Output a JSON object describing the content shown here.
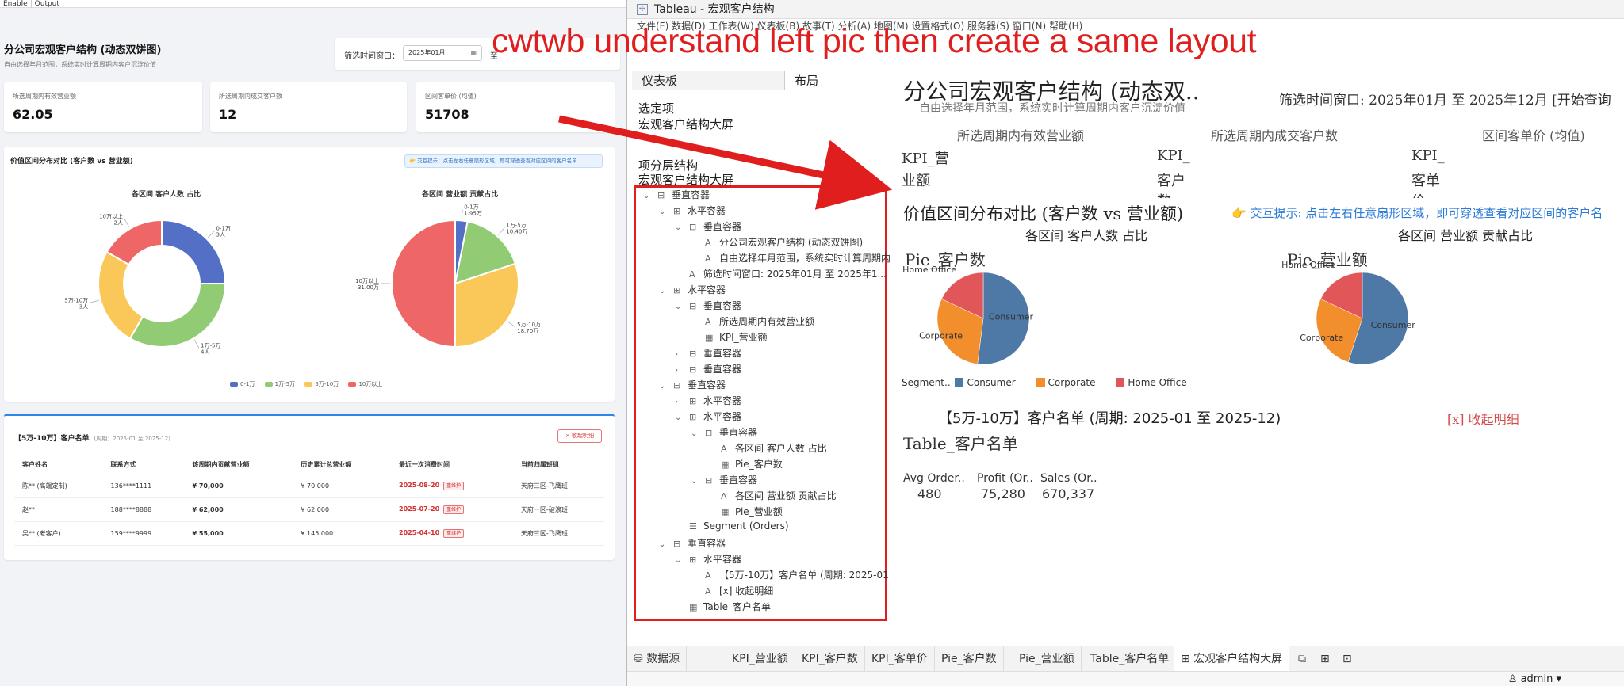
{
  "left_app": {
    "top_tabs": [
      "Enable",
      "Output"
    ],
    "title": "分公司宏观客户结构 (动态双饼图)",
    "subtitle": "自由选择年月范围，系统实时计算周期内客户沉淀价值",
    "filter_label": "筛选时间窗口：",
    "filter_from": "2025年01月",
    "filter_to_label": "至",
    "kpis": [
      {
        "label": "所选周期内有效营业额",
        "value": "62.05"
      },
      {
        "label": "所选周期内成交客户数",
        "value": "12"
      },
      {
        "label": "区间客单价 (均值)",
        "value": "51708"
      }
    ],
    "panel_title": "价值区间分布对比 (客户数 vs 营业额)",
    "tip": "👉 交互提示：点击左右任意扇形区域，即可穿透查看对应区间的客户名单",
    "donut_title": "各区间 客户人数 占比",
    "pie_title": "各区间 营业额 贡献占比",
    "legend": [
      "0-1万",
      "1万-5万",
      "5万-10万",
      "10万以上"
    ],
    "table_title": "【5万-10万】客户名单",
    "table_period": "(周期：2025-01 至 2025-12)",
    "collapse": "× 收起明细",
    "columns": [
      "客户姓名",
      "联系方式",
      "该周期内贡献营业额",
      "历史累计总营业额",
      "最近一次消费时间",
      "当前归属班组"
    ],
    "rows": [
      {
        "name": "陈** (高端定制)",
        "phone": "136****1111",
        "period": "¥ 70,000",
        "total": "¥ 70,000",
        "last": "2025-08-20",
        "badge": "重维护",
        "team": "天府三区-飞鹰班"
      },
      {
        "name": "赵**",
        "phone": "188****8888",
        "period": "¥ 62,000",
        "total": "¥ 62,000",
        "last": "2025-07-20",
        "badge": "重维护",
        "team": "天府一区-破浪班"
      },
      {
        "name": "吴** (老客户)",
        "phone": "159****9999",
        "period": "¥ 55,000",
        "total": "¥ 145,000",
        "last": "2025-04-10",
        "badge": "重维护",
        "team": "天府三区-飞鹰班"
      }
    ],
    "colors": {
      "c1": "#5470c6",
      "c2": "#91cc75",
      "c3": "#fac858",
      "c4": "#ee6666",
      "blue": "#1f77d6",
      "red": "#d32f2f"
    }
  },
  "chart_data": [
    {
      "type": "pie",
      "title": "各区间 客户人数 占比",
      "categories": [
        "0-1万",
        "1万-5万",
        "5万-10万",
        "10万以上"
      ],
      "values": [
        3,
        4,
        3,
        2
      ],
      "labels": [
        [
          "0-1万",
          "3人"
        ],
        [
          "1万-5万",
          "4人"
        ],
        [
          "5万-10万",
          "3人"
        ],
        [
          "10万以上",
          "2人"
        ]
      ]
    },
    {
      "type": "pie",
      "title": "各区间 营业额 贡献占比",
      "categories": [
        "0-1万",
        "1万-5万",
        "5万-10万",
        "10万以上"
      ],
      "values": [
        1.95,
        10.4,
        18.7,
        31.0
      ],
      "labels": [
        [
          "0-1万",
          "1.95万"
        ],
        [
          "1万-5万",
          "10.40万"
        ],
        [
          "5万-10万",
          "18.70万"
        ],
        [
          "10万以上",
          "31.00万"
        ]
      ]
    },
    {
      "type": "pie",
      "title": "Pie_客户数",
      "categories": [
        "Consumer",
        "Corporate",
        "Home Office"
      ],
      "values": [
        52,
        30,
        18
      ]
    },
    {
      "type": "pie",
      "title": "Pie_营业额",
      "categories": [
        "Consumer",
        "Corporate",
        "Home Office"
      ],
      "values": [
        55,
        27,
        18
      ]
    }
  ],
  "tableau": {
    "window_title": "Tableau - 宏观客户结构",
    "menu": "文件(F)  数据(D)  工作表(W)  仪表板(B)  故事(T)  分析(A)  地图(M)  设置格式(O)  服务器(S)  窗口(N)  帮助(H)",
    "tabs": [
      "仪表板",
      "布局"
    ],
    "selected_label": "选定项",
    "selected_value": "宏观客户结构大屏",
    "hierarchy_label": "项分层结构",
    "hierarchy_value": "宏观客户结构大屏",
    "tree": [
      {
        "d": 0,
        "ar": "⌄",
        "ic": "⊟",
        "t": "垂直容器"
      },
      {
        "d": 1,
        "ar": "⌄",
        "ic": "⊞",
        "t": "水平容器"
      },
      {
        "d": 2,
        "ar": "⌄",
        "ic": "⊟",
        "t": "垂直容器"
      },
      {
        "d": 3,
        "ar": "",
        "ic": "A",
        "t": "分公司宏观客户结构 (动态双饼图)"
      },
      {
        "d": 3,
        "ar": "",
        "ic": "A",
        "t": "自由选择年月范围，系统实时计算周期内"
      },
      {
        "d": 2,
        "ar": "",
        "ic": "A",
        "t": "筛选时间窗口: 2025年01月 至 2025年1..."
      },
      {
        "d": 1,
        "ar": "⌄",
        "ic": "⊞",
        "t": "水平容器"
      },
      {
        "d": 2,
        "ar": "⌄",
        "ic": "⊟",
        "t": "垂直容器"
      },
      {
        "d": 3,
        "ar": "",
        "ic": "A",
        "t": "所选周期内有效营业额"
      },
      {
        "d": 3,
        "ar": "",
        "ic": "▦",
        "t": "KPI_营业额"
      },
      {
        "d": 2,
        "ar": "›",
        "ic": "⊟",
        "t": "垂直容器"
      },
      {
        "d": 2,
        "ar": "›",
        "ic": "⊟",
        "t": "垂直容器"
      },
      {
        "d": 1,
        "ar": "⌄",
        "ic": "⊟",
        "t": "垂直容器"
      },
      {
        "d": 2,
        "ar": "›",
        "ic": "⊞",
        "t": "水平容器"
      },
      {
        "d": 2,
        "ar": "⌄",
        "ic": "⊞",
        "t": "水平容器"
      },
      {
        "d": 3,
        "ar": "⌄",
        "ic": "⊟",
        "t": "垂直容器"
      },
      {
        "d": 4,
        "ar": "",
        "ic": "A",
        "t": "各区间 客户人数 占比"
      },
      {
        "d": 4,
        "ar": "",
        "ic": "▦",
        "t": "Pie_客户数"
      },
      {
        "d": 3,
        "ar": "⌄",
        "ic": "⊟",
        "t": "垂直容器"
      },
      {
        "d": 4,
        "ar": "",
        "ic": "A",
        "t": "各区间 营业额 贡献占比"
      },
      {
        "d": 4,
        "ar": "",
        "ic": "▦",
        "t": "Pie_营业额"
      },
      {
        "d": 2,
        "ar": "",
        "ic": "☰",
        "t": "Segment (Orders)"
      },
      {
        "d": 1,
        "ar": "⌄",
        "ic": "⊟",
        "t": "垂直容器"
      },
      {
        "d": 2,
        "ar": "⌄",
        "ic": "⊞",
        "t": "水平容器"
      },
      {
        "d": 3,
        "ar": "",
        "ic": "A",
        "t": "【5万-10万】客户名单 (周期: 2025-01"
      },
      {
        "d": 3,
        "ar": "",
        "ic": "A",
        "t": "[x] 收起明细"
      },
      {
        "d": 2,
        "ar": "",
        "ic": "▦",
        "t": "Table_客户名单"
      }
    ],
    "canvas": {
      "title": "分公司宏观客户结构 (动态双..",
      "subtitle": "自由选择年月范围，系统实时计算周期内客户沉淀价值",
      "filter": "筛选时间窗口: 2025年01月 至 2025年12月  [开始查询",
      "kpi_labels": [
        "所选周期内有效营业额",
        "所选周期内成交客户数",
        "区间客单价 (均值)"
      ],
      "kpi_names": [
        [
          "KPI_营",
          "业额"
        ],
        [
          "KPI_",
          "客户",
          "数"
        ],
        [
          "KPI_",
          "客单",
          "价"
        ]
      ],
      "section_title": "价值区间分布对比 (客户数 vs 营业额)",
      "tip": "👉 交互提示: 点击左右任意扇形区域，即可穿透查看对应区间的客户名",
      "donut_caption": "各区间 客户人数 占比",
      "pie_caption": "各区间 营业额 贡献占比",
      "pie1_name": "Pie_客户数",
      "pie2_name": "Pie_营业额",
      "seg_legend_label": "Segment..",
      "seg_legend": [
        "Consumer",
        "Corporate",
        "Home Office"
      ],
      "seg_colors": [
        "#4e79a7",
        "#f28e2b",
        "#e15759"
      ],
      "list_title": "【5万-10万】客户名单 (周期: 2025-01 至 2025-12)",
      "collapse": "[x] 收起明细",
      "table_name": "Table_客户名单",
      "measures": [
        {
          "label": "Avg Order..",
          "value": "480"
        },
        {
          "label": "Profit (Or..",
          "value": "75,280"
        },
        {
          "label": "Sales (Or..",
          "value": "670,337"
        }
      ]
    },
    "sheet_tabs": [
      "数据源",
      "KPI_营业额",
      "KPI_客户数",
      "KPI_客单价",
      "Pie_客户数",
      "Pie_营业额",
      "Table_客户名单",
      "宏观客户结构大屏"
    ],
    "user": "admin"
  },
  "annotation": "cwtwb understand left pic then create a same layout"
}
